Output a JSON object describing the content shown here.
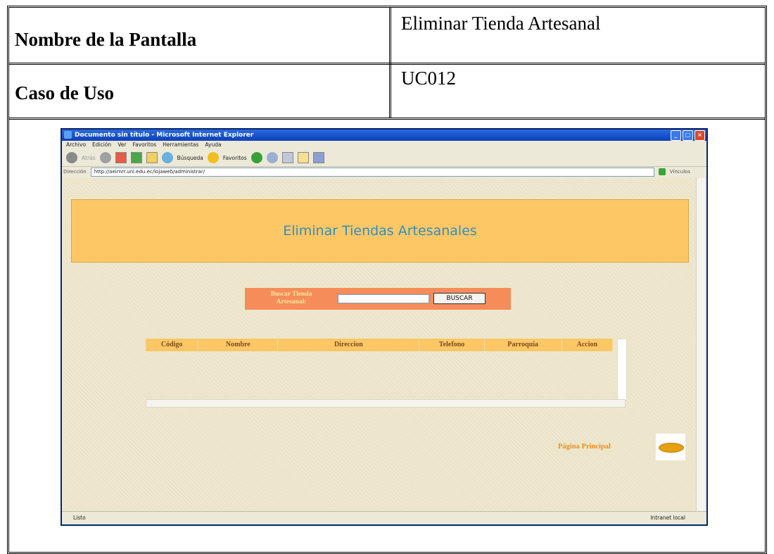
{
  "spec": {
    "screen_name_label": "Nombre de la Pantalla",
    "screen_name_value": "Eliminar Tienda Artesanal",
    "use_case_label": "Caso de Uso",
    "use_case_value": "UC012"
  },
  "browser": {
    "title": "Documento sin título - Microsoft Internet Explorer",
    "menu": [
      "Archivo",
      "Edición",
      "Ver",
      "Favoritos",
      "Herramientas",
      "Ayuda"
    ],
    "toolbar": {
      "back": "Atrás",
      "search": "Búsqueda",
      "favorites": "Favoritos"
    },
    "address_label": "Dirección",
    "address_value": "http://aeirnrr.unl.edu.ec/lojaweb/administrar/",
    "links_label": "Vínculos",
    "status_text": "Listo",
    "zone_text": "Intranet local"
  },
  "page": {
    "banner_title": "Eliminar Tiendas Artesanales",
    "search_label": "Buscar Tienda Artesanal:",
    "search_value": "",
    "search_button": "BUSCAR",
    "columns": [
      "Código",
      "Nombre",
      "Direccion",
      "Telefono",
      "Parroquia",
      "Accion"
    ],
    "home_link": "Página Principal"
  }
}
